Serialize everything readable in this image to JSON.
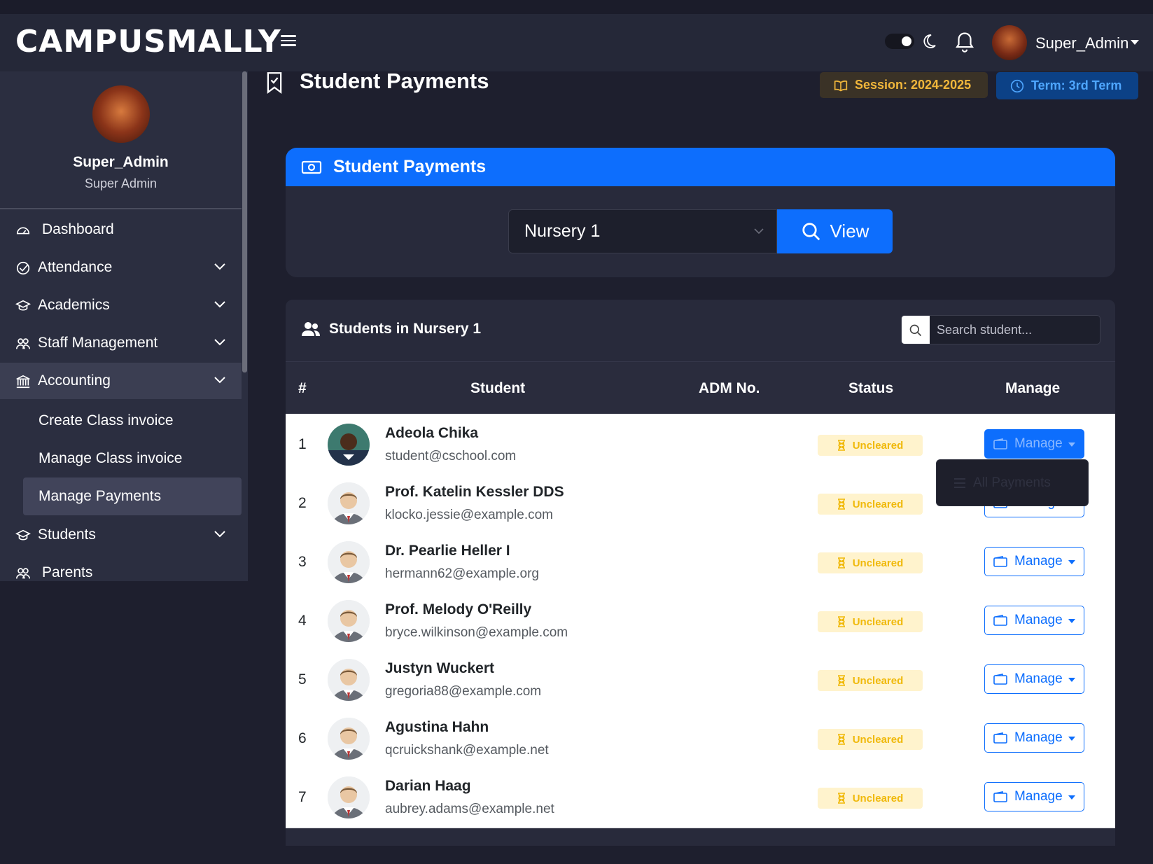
{
  "app": {
    "logo_text": "CAMPUSMALLY"
  },
  "navbar": {
    "user_name": "Super_Admin"
  },
  "sidebar": {
    "profile": {
      "name": "Super_Admin",
      "role": "Super Admin"
    },
    "items": [
      {
        "label": "Dashboard",
        "icon": "speedometer-icon"
      },
      {
        "label": "Attendance",
        "icon": "check-circle-icon"
      },
      {
        "label": "Academics",
        "icon": "graduation-cap-icon"
      },
      {
        "label": "Staff Management",
        "icon": "people-icon"
      },
      {
        "label": "Accounting",
        "icon": "bank-icon"
      },
      {
        "label": "Students",
        "icon": "graduation-cap-icon"
      },
      {
        "label": "Parents",
        "icon": "people-icon"
      }
    ],
    "accounting_sub": [
      {
        "label": "Create Class invoice"
      },
      {
        "label": "Manage Class invoice"
      },
      {
        "label": "Manage Payments"
      }
    ]
  },
  "page": {
    "title": "Student Payments",
    "session_badge": "Session: 2024-2025",
    "term_badge": "Term: 3rd Term"
  },
  "filter_card": {
    "title": "Student Payments",
    "class_select": "Nursery 1",
    "view_button": "View"
  },
  "students_card": {
    "title": "Students in Nursery 1",
    "search_placeholder": "Search student...",
    "columns": [
      "#",
      "Student",
      "ADM No.",
      "Status",
      "Manage"
    ],
    "rows": [
      {
        "num": "1",
        "name": "Adeola Chika",
        "email": "student@cschool.com",
        "adm": "",
        "status": "Uncleared",
        "manage": "Manage"
      },
      {
        "num": "2",
        "name": "Prof. Katelin Kessler DDS",
        "email": "klocko.jessie@example.com",
        "adm": "",
        "status": "Uncleared",
        "manage": "Manage"
      },
      {
        "num": "3",
        "name": "Dr. Pearlie Heller I",
        "email": "hermann62@example.org",
        "adm": "",
        "status": "Uncleared",
        "manage": "Manage"
      },
      {
        "num": "4",
        "name": "Prof. Melody O'Reilly",
        "email": "bryce.wilkinson@example.com",
        "adm": "",
        "status": "Uncleared",
        "manage": "Manage"
      },
      {
        "num": "5",
        "name": "Justyn Wuckert",
        "email": "gregoria88@example.com",
        "adm": "",
        "status": "Uncleared",
        "manage": "Manage"
      },
      {
        "num": "6",
        "name": "Agustina Hahn",
        "email": "qcruickshank@example.net",
        "adm": "",
        "status": "Uncleared",
        "manage": "Manage"
      },
      {
        "num": "7",
        "name": "Darian Haag",
        "email": "aubrey.adams@example.net",
        "adm": "",
        "status": "Uncleared",
        "manage": "Manage"
      }
    ],
    "dropdown_item": "All Payments"
  },
  "colors": {
    "primary": "#0d6efd",
    "warning": "#f0b90b",
    "sidebar_bg": "#2b2e40",
    "body_bg": "#1e1f2e"
  }
}
